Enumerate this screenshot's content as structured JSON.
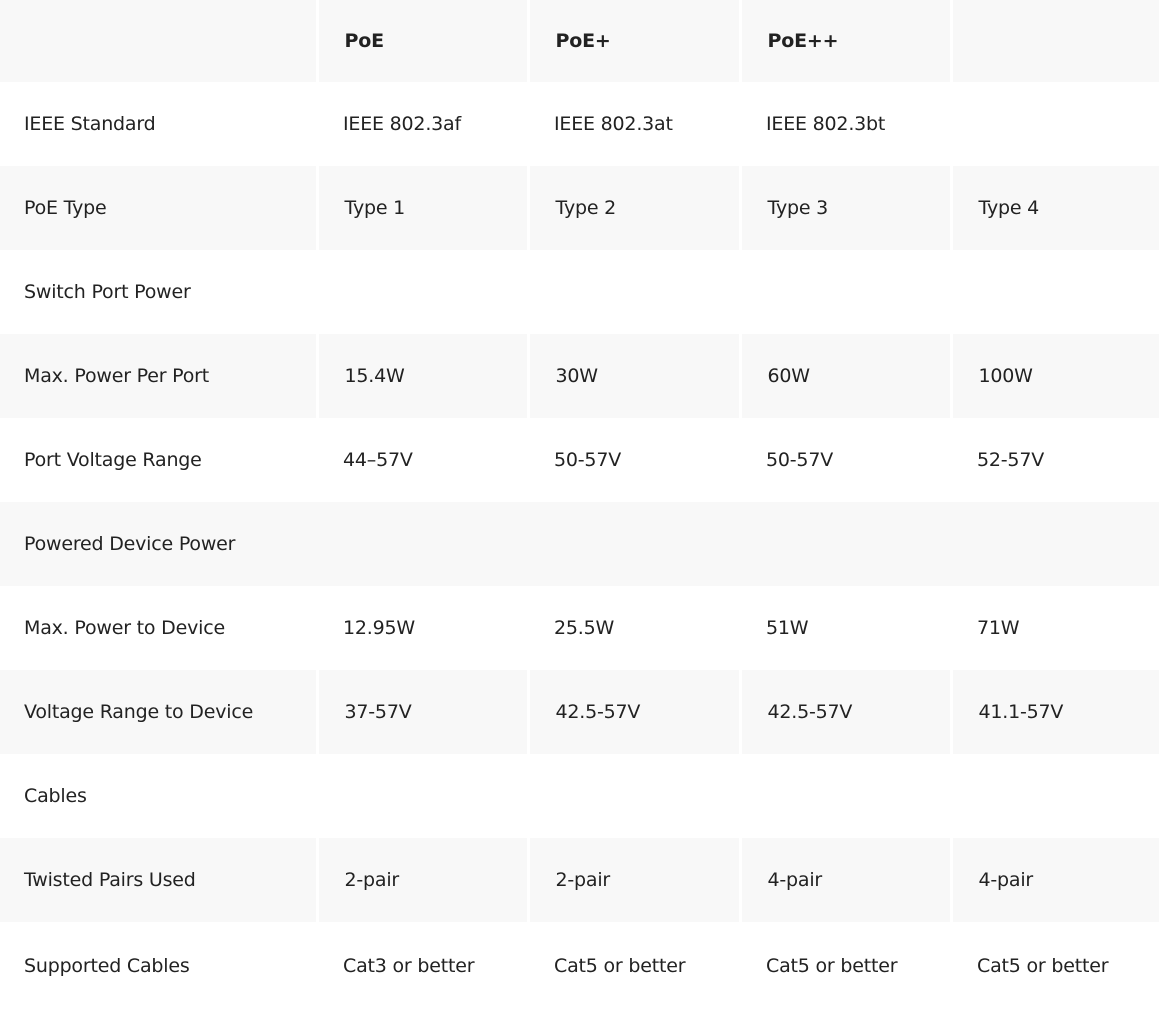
{
  "table": {
    "header": {
      "label": "",
      "poe": "PoE",
      "poe_plus": "PoE+",
      "poe_plus_plus": "PoE++"
    },
    "rows": [
      {
        "label": "IEEE Standard",
        "values": [
          "IEEE 802.3af",
          "IEEE 802.3at",
          "IEEE 802.3bt",
          ""
        ]
      },
      {
        "label": "PoE Type",
        "values": [
          "Type 1",
          "Type 2",
          "Type 3",
          "Type 4"
        ]
      },
      {
        "label": "Switch Port Power",
        "values": [
          "",
          "",
          "",
          ""
        ]
      },
      {
        "label": "Max. Power Per Port",
        "values": [
          "15.4W",
          "30W",
          "60W",
          "100W"
        ]
      },
      {
        "label": "Port Voltage Range",
        "values": [
          "44–57V",
          "50-57V",
          "50-57V",
          "52-57V"
        ]
      },
      {
        "label": "Powered Device Power",
        "values": [
          "",
          "",
          "",
          ""
        ]
      },
      {
        "label": "Max. Power to Device",
        "values": [
          "12.95W",
          "25.5W",
          "51W",
          "71W"
        ]
      },
      {
        "label": "Voltage Range to Device",
        "values": [
          "37-57V",
          "42.5-57V",
          "42.5-57V",
          "41.1-57V"
        ]
      },
      {
        "label": "Cables",
        "values": [
          "",
          "",
          "",
          ""
        ]
      },
      {
        "label": "Twisted Pairs Used",
        "values": [
          "2-pair",
          "2-pair",
          "4-pair",
          "4-pair"
        ]
      },
      {
        "label": "Supported Cables",
        "values": [
          "Cat3 or better",
          "Cat5 or better",
          "Cat5 or better",
          "Cat5 or better"
        ]
      }
    ]
  }
}
